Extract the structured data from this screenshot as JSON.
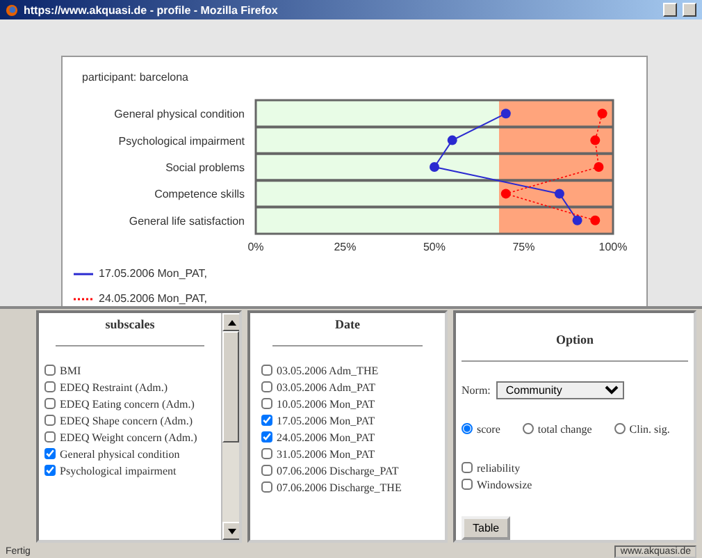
{
  "window": {
    "title": "https://www.akquasi.de - profile - Mozilla Firefox"
  },
  "profile": {
    "participant": "participant: barcelona",
    "chart_data": {
      "type": "line",
      "orientation": "horizontal",
      "categories": [
        "General physical condition",
        "Psychological impairment",
        "Social problems",
        "Competence skills",
        "General life satisfaction"
      ],
      "series": [
        {
          "name": "17.05.2006 Mon_PAT,",
          "color": "#2a2ad0",
          "marker": "o",
          "line_style": "solid",
          "values": [
            70,
            55,
            50,
            85,
            90
          ]
        },
        {
          "name": "24.05.2006 Mon_PAT,",
          "color": "#ff0000",
          "marker": "o",
          "line_style": "dotted",
          "values": [
            97,
            95,
            96,
            70,
            95
          ]
        }
      ],
      "xlim": [
        0,
        100
      ],
      "xticks": [
        {
          "value": 0,
          "label": "0%"
        },
        {
          "value": 25,
          "label": "25%"
        },
        {
          "value": 50,
          "label": "50%"
        },
        {
          "value": 75,
          "label": "75%"
        },
        {
          "value": 100,
          "label": "100%"
        }
      ]
    },
    "norm_zone": {
      "level": 0.68
    }
  },
  "subscales": {
    "title": "subscales",
    "items": [
      {
        "label": "BMI",
        "checked": false
      },
      {
        "label": "EDEQ Restraint (Adm.)",
        "checked": false
      },
      {
        "label": "EDEQ Eating concern (Adm.)",
        "checked": false
      },
      {
        "label": "EDEQ Shape concern (Adm.)",
        "checked": false
      },
      {
        "label": "EDEQ Weight concern (Adm.)",
        "checked": false
      },
      {
        "label": "General physical condition",
        "checked": true
      },
      {
        "label": "Psychological impairment",
        "checked": true
      }
    ]
  },
  "dates": {
    "title": "Date",
    "items": [
      {
        "label": "03.05.2006 Adm_THE",
        "checked": false
      },
      {
        "label": "03.05.2006 Adm_PAT",
        "checked": false
      },
      {
        "label": "10.05.2006 Mon_PAT",
        "checked": false
      },
      {
        "label": "17.05.2006 Mon_PAT",
        "checked": true
      },
      {
        "label": "24.05.2006 Mon_PAT",
        "checked": true
      },
      {
        "label": "31.05.2006 Mon_PAT",
        "checked": false
      },
      {
        "label": "07.06.2006 Discharge_PAT",
        "checked": false
      },
      {
        "label": "07.06.2006 Discharge_THE",
        "checked": false
      }
    ]
  },
  "option": {
    "title": "Option",
    "norm_label": "Norm:",
    "norm_value": "Community",
    "modes": [
      {
        "label": "score",
        "selected": true
      },
      {
        "label": "total change",
        "selected": false
      },
      {
        "label": "Clin. sig.",
        "selected": false
      }
    ],
    "checks": [
      {
        "label": "reliability",
        "checked": false
      },
      {
        "label": "Windowsize",
        "checked": false
      }
    ],
    "button": "Table"
  },
  "status_bar": {
    "left": "Fertig",
    "right": "www.akquasi.de"
  }
}
